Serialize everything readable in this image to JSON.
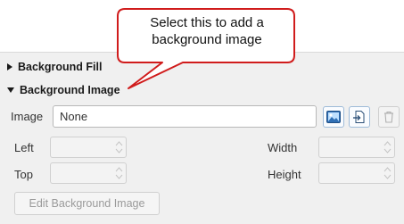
{
  "callout": {
    "text_line1": "Select this to add a",
    "text_line2": "background image"
  },
  "sections": {
    "fill_label": "Background Fill",
    "image_label": "Background Image"
  },
  "image_field": {
    "label": "Image",
    "value": "None"
  },
  "fields": {
    "left": "Left",
    "top": "Top",
    "width": "Width",
    "height": "Height"
  },
  "edit_button": {
    "label": "Edit Background Image"
  },
  "icons": {
    "browse": "image-picture-icon",
    "import": "import-file-icon",
    "delete": "trash-icon",
    "collapsed": "triangle-right-icon",
    "expanded": "triangle-down-icon"
  },
  "colors": {
    "callout_border": "#d01c1c",
    "accent": "#2f6fb5"
  }
}
